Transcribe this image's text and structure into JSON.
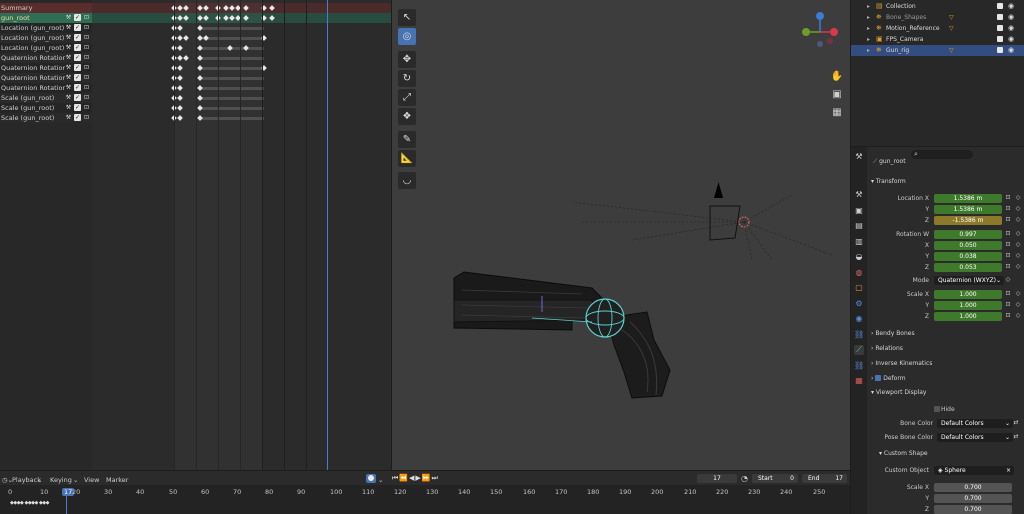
{
  "dopesheet": {
    "channels": [
      {
        "label": "Summary",
        "kind": "summary"
      },
      {
        "label": "gun_root",
        "kind": "group"
      },
      {
        "label": "Location (gun_root)",
        "kind": "fcurve"
      },
      {
        "label": "Location (gun_root)",
        "kind": "fcurve"
      },
      {
        "label": "Location (gun_root)",
        "kind": "fcurve"
      },
      {
        "label": "Quaternion Rotation (gun_root)",
        "kind": "fcurve"
      },
      {
        "label": "Quaternion Rotation (gun_root)",
        "kind": "fcurve"
      },
      {
        "label": "Quaternion Rotation (gun_root)",
        "kind": "fcurve"
      },
      {
        "label": "Quaternion Rotation (gun_root)",
        "kind": "fcurve"
      },
      {
        "label": "Scale (gun_root)",
        "kind": "fcurve"
      },
      {
        "label": "Scale (gun_root)",
        "kind": "fcurve"
      },
      {
        "label": "Scale (gun_root)",
        "kind": "fcurve"
      }
    ]
  },
  "viewport": {
    "tools": [
      "select-tool",
      "cursor-tool",
      "move-tool",
      "rotate-tool",
      "scale-tool",
      "transform-tool",
      "annotate-tool",
      "measure-tool",
      "bone-size-tool"
    ],
    "active_tool": 1,
    "gizmo": {
      "x_label": "X",
      "y_label": "Y",
      "z_label": "Z",
      "x_color": "#d8374e",
      "y_color": "#6e9e2a",
      "z_color": "#3f7ad6"
    }
  },
  "outliner": {
    "rows": [
      {
        "label": "Collection"
      },
      {
        "label": "Bone_Shapes"
      },
      {
        "label": "Motion_Reference"
      },
      {
        "label": "FPS_Camera"
      },
      {
        "label": "Gun_rig"
      }
    ]
  },
  "properties": {
    "search_placeholder": "",
    "bone_name": "gun_root",
    "transform": {
      "header": "Transform",
      "location_label": "Location X",
      "y_label": "Y",
      "z_label": "Z",
      "x_label": "X",
      "location": [
        "1.5386 m",
        "1.5386 m",
        "-1.5386 m"
      ],
      "rotation_label": "Rotation W",
      "rotation": [
        "0.997",
        "0.050",
        "0.038",
        "0.053"
      ],
      "mode_label": "Mode",
      "mode_value": "Quaternion (WXYZ)",
      "scale_label": "Scale X",
      "scale": [
        "1.000",
        "1.000",
        "1.000"
      ]
    },
    "panels": {
      "bendy_bones": "Bendy Bones",
      "relations": "Relations",
      "inverse_kinematics": "Inverse Kinematics",
      "deform": "Deform",
      "viewport_display": "Viewport Display"
    },
    "viewport_display": {
      "hide_label": "Hide",
      "bone_color_label": "Bone Color",
      "bone_color_value": "Default Colors",
      "pose_bone_color_label": "Pose Bone Color",
      "pose_bone_color_value": "Default Colors",
      "custom_shape_header": "Custom Shape",
      "custom_object_label": "Custom Object",
      "custom_object_value": "Sphere",
      "scale_label": "Scale X",
      "y_label": "Y",
      "z_label": "Z",
      "scale": [
        "0.700",
        "0.700",
        "0.700"
      ]
    }
  },
  "timeline": {
    "menus": [
      "Playback",
      "Keying",
      "View",
      "Marker"
    ],
    "current_frame": "17",
    "start_label": "Start",
    "start_value": "0",
    "end_label": "End",
    "end_value": "17",
    "ticks": [
      "0",
      "10",
      "17",
      "20",
      "30",
      "40",
      "50",
      "60",
      "70",
      "80",
      "90",
      "100",
      "110",
      "120",
      "130",
      "140",
      "150",
      "160",
      "170",
      "180",
      "190",
      "200",
      "210",
      "220",
      "230",
      "240",
      "250"
    ]
  }
}
